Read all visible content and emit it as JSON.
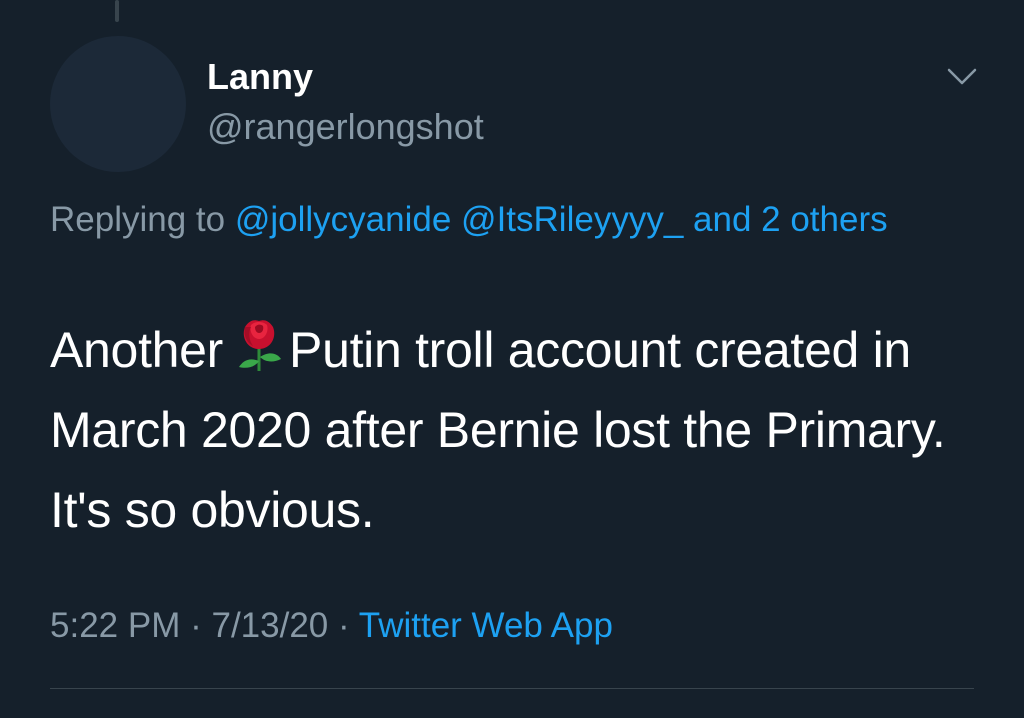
{
  "tweet": {
    "author": {
      "display_name": "Lanny",
      "handle": "@rangerlongshot"
    },
    "reply": {
      "prefix": "Replying to",
      "mention_1": "@jollycyanide",
      "mention_2": "@ItsRileyyyy_",
      "others": "and 2 others"
    },
    "text": {
      "before_emoji": "Another",
      "emoji": "rose-emoji",
      "after_emoji": "Putin troll account created in March 2020 after Bernie lost the Primary. It's so obvious."
    },
    "meta": {
      "time": "5:22 PM",
      "separator": "·",
      "date": "7/13/20",
      "source": "Twitter Web App"
    }
  },
  "icons": {
    "menu": "chevron-down-icon"
  },
  "colors": {
    "background": "#15202b",
    "primary_text": "#ffffff",
    "secondary_text": "#8899a6",
    "link": "#1da1f2",
    "divider": "#38444d"
  }
}
